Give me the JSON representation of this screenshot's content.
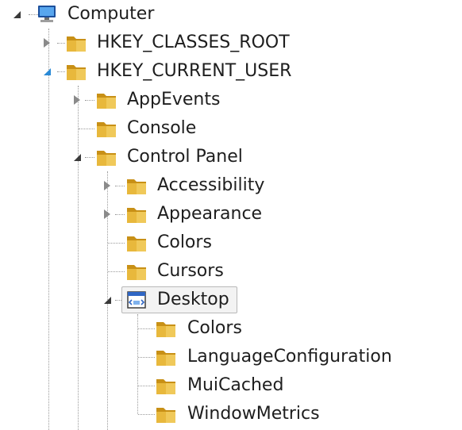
{
  "tree": {
    "root": {
      "label": "Computer",
      "icon": "computer-icon",
      "state": "expanded"
    },
    "nodes": [
      {
        "label": "HKEY_CLASSES_ROOT",
        "icon": "folder-icon",
        "state": "collapsed"
      },
      {
        "label": "HKEY_CURRENT_USER",
        "icon": "folder-icon",
        "state": "expanded"
      },
      {
        "label": "AppEvents",
        "icon": "folder-icon",
        "state": "collapsed"
      },
      {
        "label": "Console",
        "icon": "folder-icon",
        "state": "leaf"
      },
      {
        "label": "Control Panel",
        "icon": "folder-icon",
        "state": "expanded"
      },
      {
        "label": "Accessibility",
        "icon": "folder-icon",
        "state": "collapsed"
      },
      {
        "label": "Appearance",
        "icon": "folder-icon",
        "state": "collapsed"
      },
      {
        "label": "Colors",
        "icon": "folder-icon",
        "state": "leaf"
      },
      {
        "label": "Cursors",
        "icon": "folder-icon",
        "state": "leaf"
      },
      {
        "label": "Desktop",
        "icon": "registry-key-icon",
        "state": "expanded",
        "selected": true
      },
      {
        "label": "Colors",
        "icon": "folder-icon",
        "state": "leaf"
      },
      {
        "label": "LanguageConfiguration",
        "icon": "folder-icon",
        "state": "leaf"
      },
      {
        "label": "MuiCached",
        "icon": "folder-icon",
        "state": "leaf"
      },
      {
        "label": "WindowMetrics",
        "icon": "folder-icon",
        "state": "leaf"
      }
    ]
  },
  "colors": {
    "folder": "#e8b83c",
    "folder_dark": "#c89016",
    "guide_lines": "#9a9a9a",
    "expander_accent": "#2a8ad6",
    "selection_border": "#b8b8b8"
  }
}
